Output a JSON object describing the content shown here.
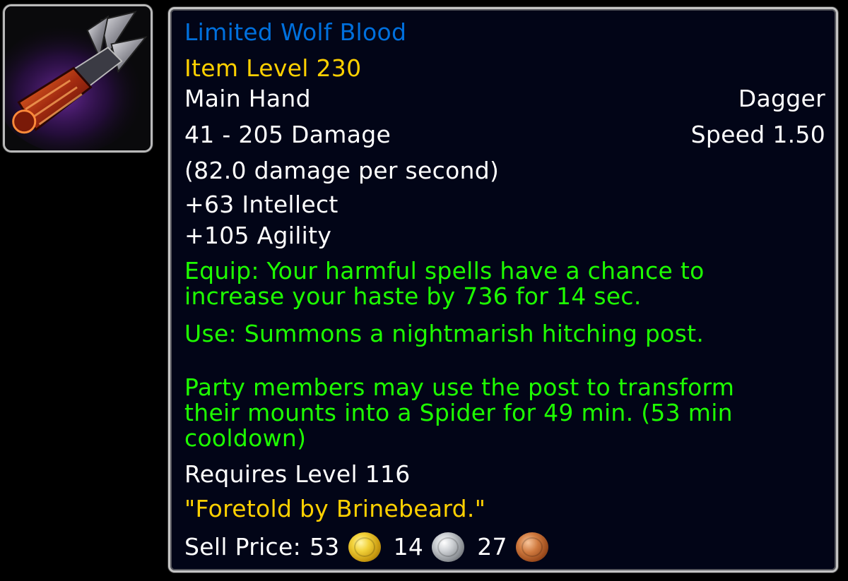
{
  "item": {
    "name": "Limited Wolf Blood",
    "item_level": "Item Level 230",
    "slot": "Main Hand",
    "type": "Dagger",
    "damage": "41 - 205 Damage",
    "speed": "Speed 1.50",
    "dps": "(82.0 damage per second)",
    "stats": [
      "+63 Intellect",
      "+105 Agility"
    ],
    "equip_effect": "Equip: Your harmful spells have a chance to increase your haste by 736 for 14 sec.",
    "use_effect": "Use: Summons a nightmarish hitching post.",
    "use_effect_detail": "Party members may use the post to transform their mounts into a Spider for 49 min. (53 min cooldown)",
    "requirement": "Requires Level 116",
    "flavor": "\"Foretold by Brinebeard.\"",
    "sell_price": {
      "label": "Sell Price:",
      "gold": "53",
      "silver": "14",
      "copper": "27"
    },
    "icon": "dagger-icon"
  },
  "colors": {
    "name_quality": "#0070dd",
    "item_level": "#ffd100",
    "effect": "#1eff00",
    "flavor": "#ffd100",
    "text": "#ffffff",
    "background": "#020517"
  }
}
